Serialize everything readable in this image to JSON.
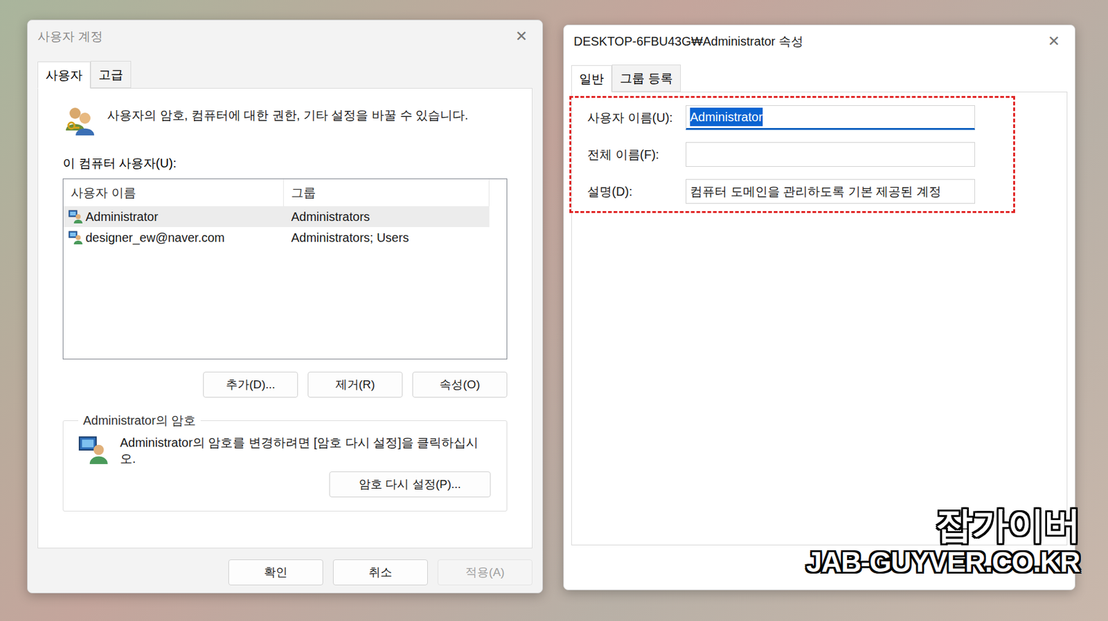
{
  "desktop": {
    "watermark": [
      "잡가이버",
      "JAB-GUYVER.CO.KR"
    ]
  },
  "user_accounts_window": {
    "title": "사용자 계정",
    "close": "✕",
    "tabs": [
      {
        "label": "사용자",
        "selected": true
      },
      {
        "label": "고급",
        "selected": false
      }
    ],
    "description": "사용자의 암호, 컴퓨터에 대한 권한, 기타 설정을 바꿀 수 있습니다.",
    "users_label": "이 컴퓨터 사용자(U):",
    "table": {
      "columns": [
        "사용자 이름",
        "그룹"
      ],
      "rows": [
        {
          "user": "Administrator",
          "group": "Administrators",
          "selected": true
        },
        {
          "user": "designer_ew@naver.com",
          "group": "Administrators; Users",
          "selected": false
        }
      ]
    },
    "buttons": [
      "추가(D)...",
      "제거(R)",
      "속성(O)"
    ],
    "password_group": {
      "title": "Administrator의 암호",
      "text": "Administrator의 암호를 변경하려면 [암호 다시 설정]을 클릭하십시오.",
      "button": "암호 다시 설정(P)..."
    },
    "footer_buttons": [
      {
        "label": "확인",
        "disabled": false
      },
      {
        "label": "취소",
        "disabled": false
      },
      {
        "label": "적용(A)",
        "disabled": true
      }
    ]
  },
  "properties_window": {
    "title": "DESKTOP-6FBU43G₩Administrator 속성",
    "close": "✕",
    "tabs": [
      {
        "label": "일반",
        "selected": true
      },
      {
        "label": "그룹 등록",
        "selected": false
      }
    ],
    "fields": [
      {
        "label": "사용자 이름(U):",
        "value": "Administrator",
        "selected": true
      },
      {
        "label": "전체 이름(F):",
        "value": "",
        "selected": false
      },
      {
        "label": "설명(D):",
        "value": "컴퓨터 도메인을 관리하도록 기본 제공된 계정",
        "selected": false
      }
    ]
  }
}
